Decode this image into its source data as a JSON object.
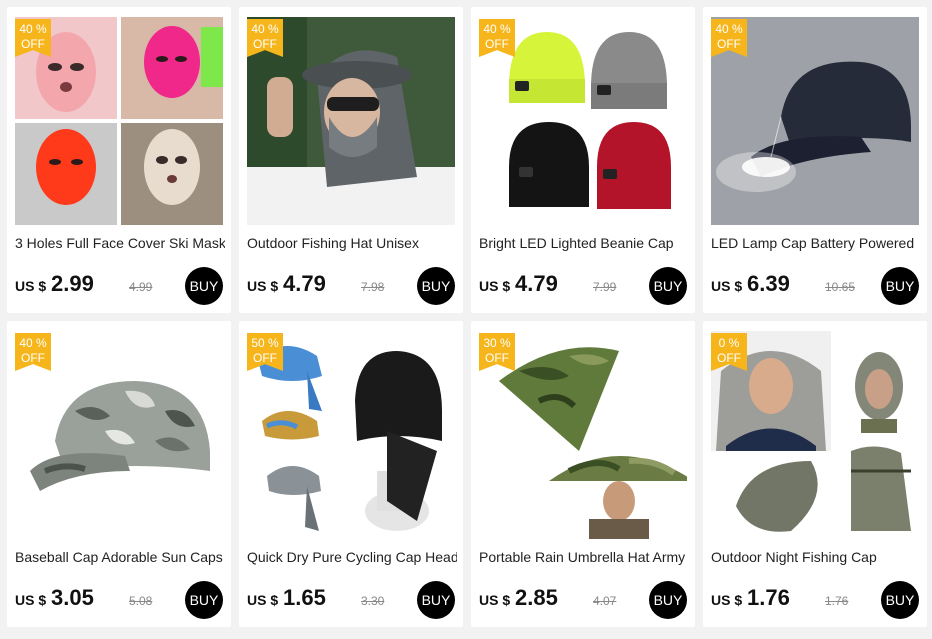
{
  "products": [
    {
      "title": "3 Holes Full Face Cover Ski Mask",
      "discount": "40 %",
      "off": "OFF",
      "currency": "US $",
      "price": "2.99",
      "old_price": "4.99",
      "buy_label": "BUY",
      "image": "ski-mask-image"
    },
    {
      "title": "Outdoor Fishing Hat Unisex",
      "discount": "40 %",
      "off": "OFF",
      "currency": "US $",
      "price": "4.79",
      "old_price": "7.98",
      "buy_label": "BUY",
      "image": "fishing-hat-image"
    },
    {
      "title": "Bright LED Lighted Beanie Cap",
      "discount": "40 %",
      "off": "OFF",
      "currency": "US $",
      "price": "4.79",
      "old_price": "7.99",
      "buy_label": "BUY",
      "image": "led-beanie-image"
    },
    {
      "title": "LED Lamp Cap Battery Powered",
      "discount": "40 %",
      "off": "OFF",
      "currency": "US $",
      "price": "6.39",
      "old_price": "10.65",
      "buy_label": "BUY",
      "image": "led-cap-image"
    },
    {
      "title": "Baseball Cap Adorable Sun Caps",
      "discount": "40 %",
      "off": "OFF",
      "currency": "US $",
      "price": "3.05",
      "old_price": "5.08",
      "buy_label": "BUY",
      "image": "camo-cap-image"
    },
    {
      "title": "Quick Dry Pure Cycling Cap Head",
      "discount": "50 %",
      "off": "OFF",
      "currency": "US $",
      "price": "1.65",
      "old_price": "3.30",
      "buy_label": "BUY",
      "image": "cycling-cap-image"
    },
    {
      "title": "Portable Rain Umbrella Hat Army",
      "discount": "30 %",
      "off": "OFF",
      "currency": "US $",
      "price": "2.85",
      "old_price": "4.07",
      "buy_label": "BUY",
      "image": "umbrella-hat-image"
    },
    {
      "title": "Outdoor Night Fishing Cap",
      "discount": "0 %",
      "off": "OFF",
      "currency": "US $",
      "price": "1.76",
      "old_price": "1.76",
      "buy_label": "BUY",
      "image": "mosquito-net-hat-image"
    }
  ],
  "colors": {
    "badge": "#f5b51b",
    "buy_button": "#000000",
    "background": "#f2f2f2"
  }
}
